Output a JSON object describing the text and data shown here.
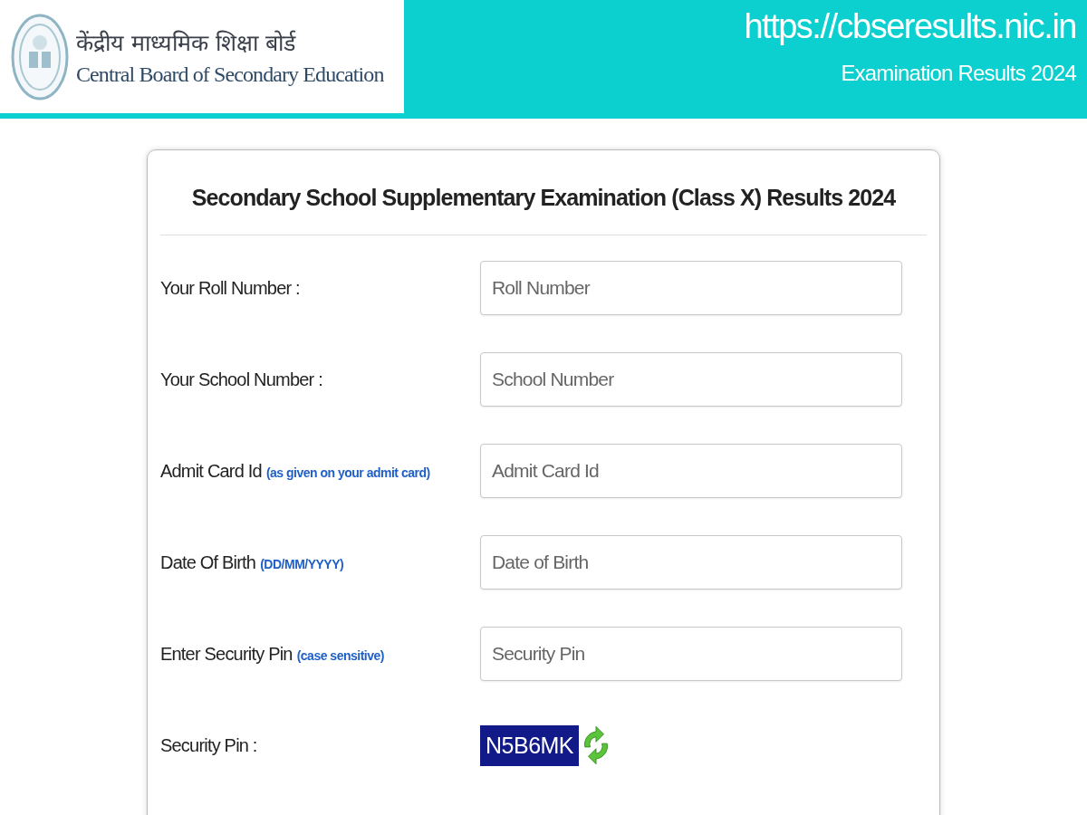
{
  "header": {
    "logo": {
      "hindi": "केंद्रीय माध्यमिक शिक्षा बोर्ड",
      "english": "Central Board of Secondary Education"
    },
    "url": "https://cbseresults.nic.in",
    "subtitle": "Examination Results 2024"
  },
  "form": {
    "title": "Secondary School Supplementary Examination (Class X) Results 2024",
    "fields": [
      {
        "label": "Your Roll Number :",
        "placeholder": "Roll Number"
      },
      {
        "label": "Your School Number :",
        "placeholder": "School Number"
      },
      {
        "label": "Admit Card Id",
        "hint": "(as given on your admit card)",
        "placeholder": "Admit Card Id"
      },
      {
        "label": "Date Of Birth",
        "hint": "(DD/MM/YYYY)",
        "placeholder": "Date of Birth"
      },
      {
        "label": "Enter Security Pin",
        "hint": "(case sensitive)",
        "placeholder": "Security Pin"
      }
    ],
    "captcha": {
      "label": "Security Pin :",
      "code": "N5B6MK"
    }
  }
}
